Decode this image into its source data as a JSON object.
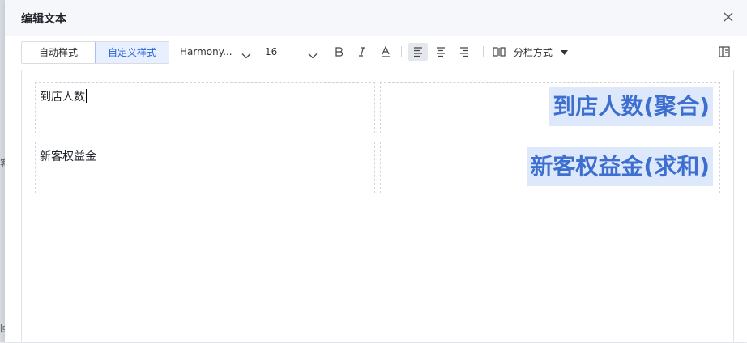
{
  "dialog": {
    "title": "编辑文本",
    "close_icon": "close-icon"
  },
  "backdrop": {
    "fragment_1": "客",
    "fragment_2": "回"
  },
  "toolbar": {
    "style_tabs": [
      {
        "label": "自动样式",
        "active": false
      },
      {
        "label": "自定义样式",
        "active": true
      }
    ],
    "font_family": "Harmony...",
    "font_size": "16",
    "bold_icon": "bold-icon",
    "italic_icon": "italic-icon",
    "text_color_icon": "text-color-icon",
    "align_left_icon": "align-left-icon",
    "align_center_icon": "align-center-icon",
    "align_right_icon": "align-right-icon",
    "column_mode_label": "分栏方式",
    "side_panel_icon": "side-panel-icon"
  },
  "rows": [
    {
      "label": "到店人数",
      "field": "到店人数(聚合)",
      "has_caret": true
    },
    {
      "label": "新客权益金",
      "field": "新客权益金(求和)",
      "has_caret": false
    }
  ],
  "colors": {
    "accent": "#2862d7",
    "chip_bg": "#dde8fb",
    "chip_text": "#3d6fd0"
  }
}
